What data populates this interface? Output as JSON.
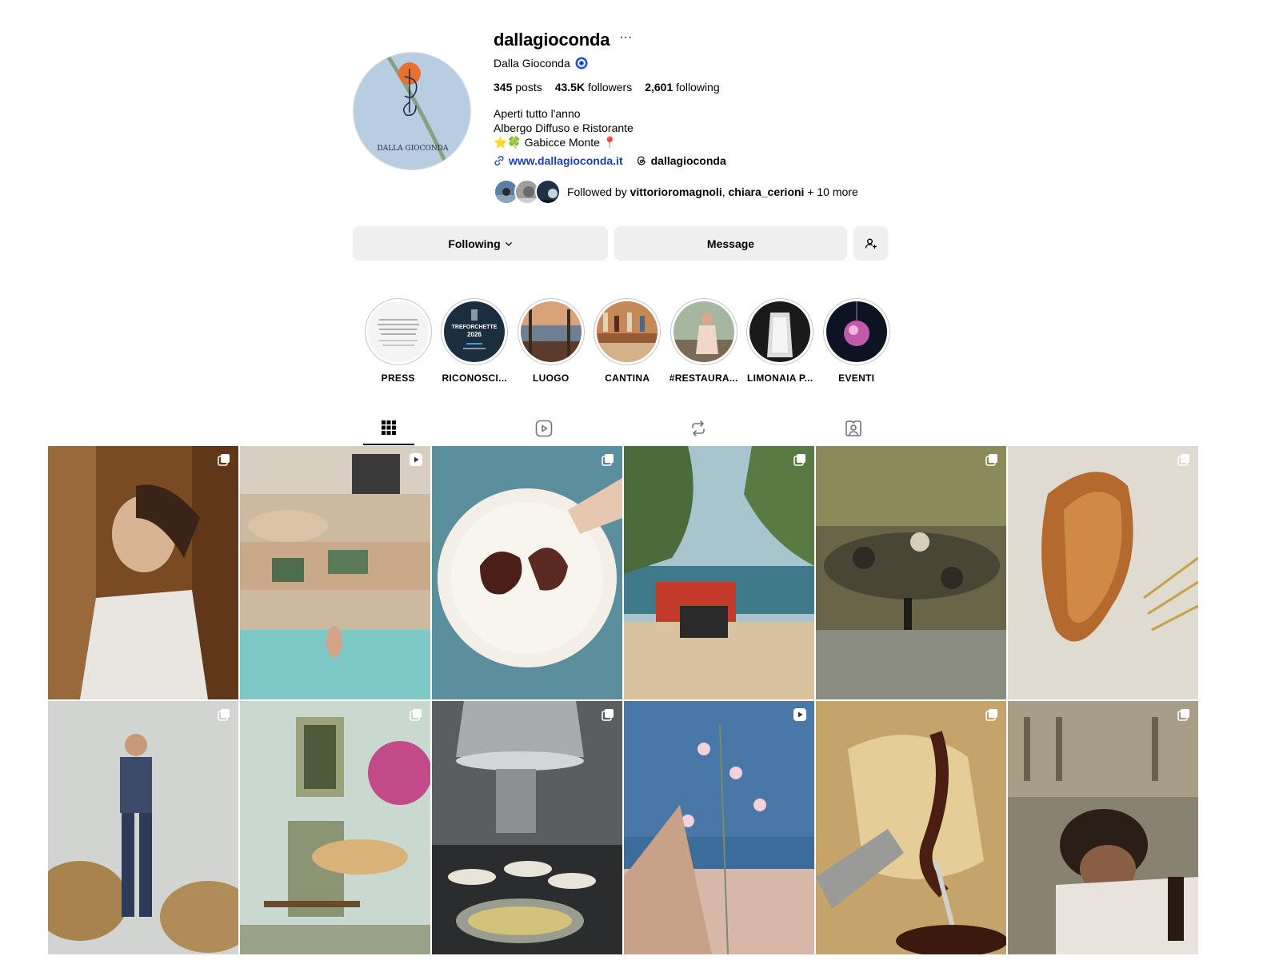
{
  "profile": {
    "username": "dallagioconda",
    "more_glyph": "···",
    "full_name": "Dalla Gioconda",
    "avatar_text": "DALLA GIOCONDA",
    "stats": {
      "posts_value": "345",
      "posts_label": " posts",
      "followers_value": "43.5K",
      "followers_label": " followers",
      "following_value": "2,601",
      "following_label": " following"
    },
    "bio": [
      "Aperti tutto l'anno",
      "Albergo Diffuso e Ristorante",
      "⭐️🍀 Gabicce Monte 📍"
    ],
    "website": "www.dallagioconda.it",
    "threads_handle": "dallagioconda",
    "followed_by": {
      "prefix": "Followed by ",
      "user1": "vittorioromagnoli",
      "sep": ", ",
      "user2": "chiara_cerioni",
      "suffix": " + 10 more"
    }
  },
  "buttons": {
    "following": "Following",
    "message": "Message"
  },
  "highlights": [
    {
      "label": "PRESS",
      "img_text": "Un nuovo capitolo per Dalla Gioconda"
    },
    {
      "label": "RICONOSCI...",
      "img_text": "TREFORCHETTE",
      "img_sub": "2026"
    },
    {
      "label": "LUOGO"
    },
    {
      "label": "CANTINA"
    },
    {
      "label": "#RESTAURA..."
    },
    {
      "label": "LIMONAIA P..."
    },
    {
      "label": "EVENTI"
    }
  ],
  "tabs": [
    {
      "icon": "grid-icon",
      "active": true
    },
    {
      "icon": "reels-icon",
      "active": false
    },
    {
      "icon": "reposts-icon",
      "active": false
    },
    {
      "icon": "tagged-icon",
      "active": false
    }
  ],
  "colors": {
    "link": "#1a3fb8",
    "button_bg": "#efefef",
    "verified": "#0095f6"
  }
}
